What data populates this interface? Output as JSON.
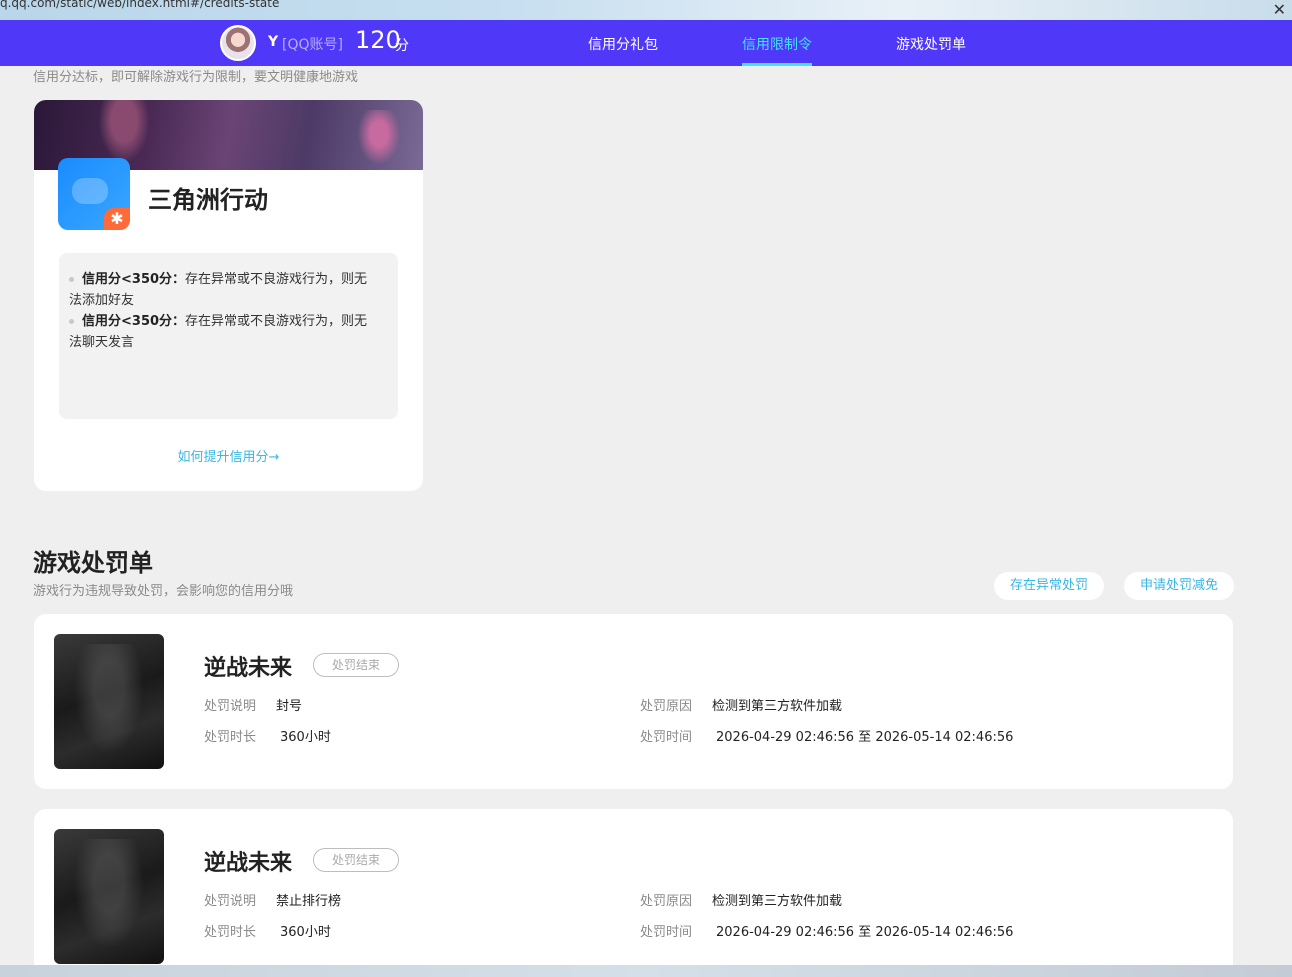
{
  "browser": {
    "url": "q.qq.com/static/web/index.html#/credits-state",
    "close_icon": "close-icon"
  },
  "header": {
    "user_name": "Y",
    "account_tag": "[QQ账号]",
    "score": "120",
    "score_unit": "分",
    "nav": [
      {
        "label": "信用分礼包",
        "active": false
      },
      {
        "label": "信用限制令",
        "active": true
      },
      {
        "label": "游戏处罚单",
        "active": false
      }
    ],
    "accent": "#5038f8",
    "active_color": "#3ee6ff"
  },
  "restriction": {
    "subtitle": "信用分达标，即可解除游戏行为限制，要文明健康地游戏",
    "game_name": "三角洲行动",
    "rules": [
      {
        "bold": "信用分<350分：",
        "text": "存在异常或不良游戏行为，则无法添加好友"
      },
      {
        "bold": "信用分<350分：",
        "text": "存在异常或不良游戏行为，则无法聊天发言"
      }
    ],
    "improve_link": "如何提升信用分→"
  },
  "penalty": {
    "title": "游戏处罚单",
    "subtitle": "游戏行为违规导致处罚，会影响您的信用分哦",
    "btn_abnormal": "存在异常处罚",
    "btn_appeal": "申请处罚减免",
    "labels": {
      "desc": "处罚说明",
      "duration": "处罚时长",
      "reason": "处罚原因",
      "time": "处罚时间"
    },
    "items": [
      {
        "game": "逆战未来",
        "status": "处罚结束",
        "desc": "封号",
        "duration": "360小时",
        "reason": "检测到第三方软件加载",
        "time": "2026-04-29 02:46:56 至 2026-05-14 02:46:56"
      },
      {
        "game": "逆战未来",
        "status": "处罚结束",
        "desc": "禁止排行榜",
        "duration": "360小时",
        "reason": "检测到第三方软件加载",
        "time": "2026-04-29 02:46:56 至 2026-05-14 02:46:56"
      }
    ]
  }
}
